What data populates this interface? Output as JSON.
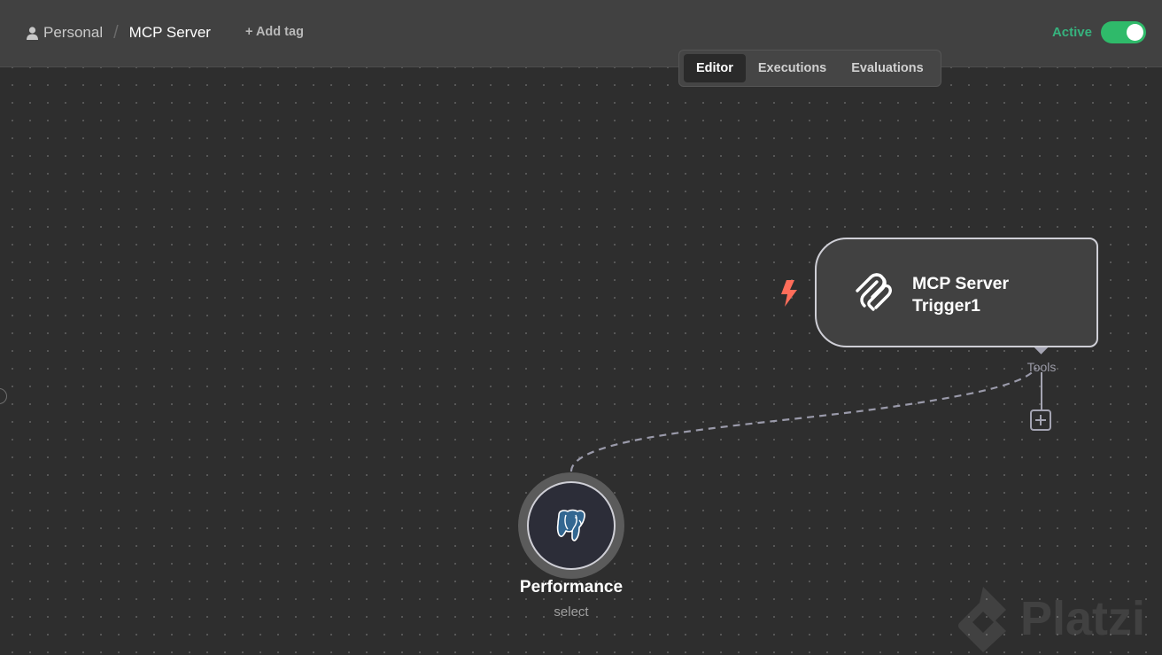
{
  "header": {
    "breadcrumb_project": "Personal",
    "breadcrumb_separator": "/",
    "workflow_name": "MCP Server",
    "add_tag_label": "+ Add tag",
    "active_label": "Active",
    "active_state": true
  },
  "tabs": [
    {
      "label": "Editor",
      "selected": true
    },
    {
      "label": "Executions",
      "selected": false
    },
    {
      "label": "Evaluations",
      "selected": false
    }
  ],
  "canvas": {
    "trigger_node": {
      "title_line1": "MCP Server",
      "title_line2": "Trigger1",
      "icon": "mcp-icon",
      "trigger_badge_icon": "lightning-bolt-icon",
      "output_label": "Tools"
    },
    "tool_node": {
      "title": "Performance",
      "subtitle": "select",
      "icon": "postgres-elephant-icon"
    }
  },
  "colors": {
    "accent_active": "#36b37e",
    "toggle_on": "#2fba6a",
    "trigger_bolt": "#ff6d5a",
    "canvas_bg": "#2e2e2e",
    "header_bg": "#414141"
  },
  "watermark": "Platzi"
}
